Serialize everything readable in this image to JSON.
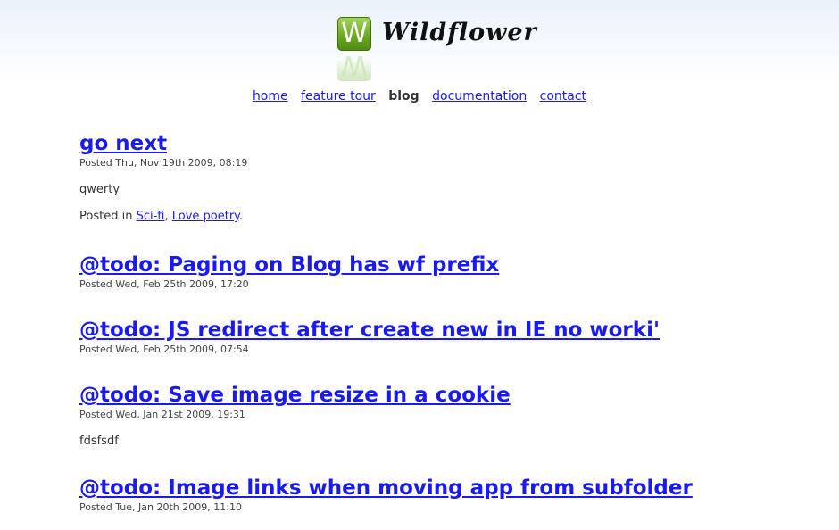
{
  "site": {
    "logo_letter": "W",
    "logo_text": "Wildflower"
  },
  "nav": {
    "items": [
      {
        "label": "home",
        "current": false
      },
      {
        "label": "feature tour",
        "current": false
      },
      {
        "label": "blog",
        "current": true
      },
      {
        "label": "documentation",
        "current": false
      },
      {
        "label": "contact",
        "current": false
      }
    ]
  },
  "posts": [
    {
      "title": "go next",
      "meta": "Posted Thu, Nov 19th 2009, 08:19",
      "body": "qwerty",
      "categories_prefix": "Posted in ",
      "categories": [
        "Sci-fi",
        "Love poetry"
      ],
      "categories_suffix": "."
    },
    {
      "title": "@todo: Paging on Blog has wf prefix",
      "meta": "Posted Wed, Feb 25th 2009, 17:20"
    },
    {
      "title": "@todo: JS redirect after create new in IE no worki'",
      "meta": "Posted Wed, Feb 25th 2009, 07:54"
    },
    {
      "title": "@todo: Save image resize in a cookie",
      "meta": "Posted Wed, Jan 21st 2009, 19:31",
      "body": "fdsfsdf"
    },
    {
      "title": "@todo: Image links when moving app from subfolder",
      "meta": "Posted Tue, Jan 20th 2009, 11:10"
    }
  ],
  "colors": {
    "link": "#1a1aee",
    "text": "#333333",
    "logo_green": "#6aa520"
  }
}
